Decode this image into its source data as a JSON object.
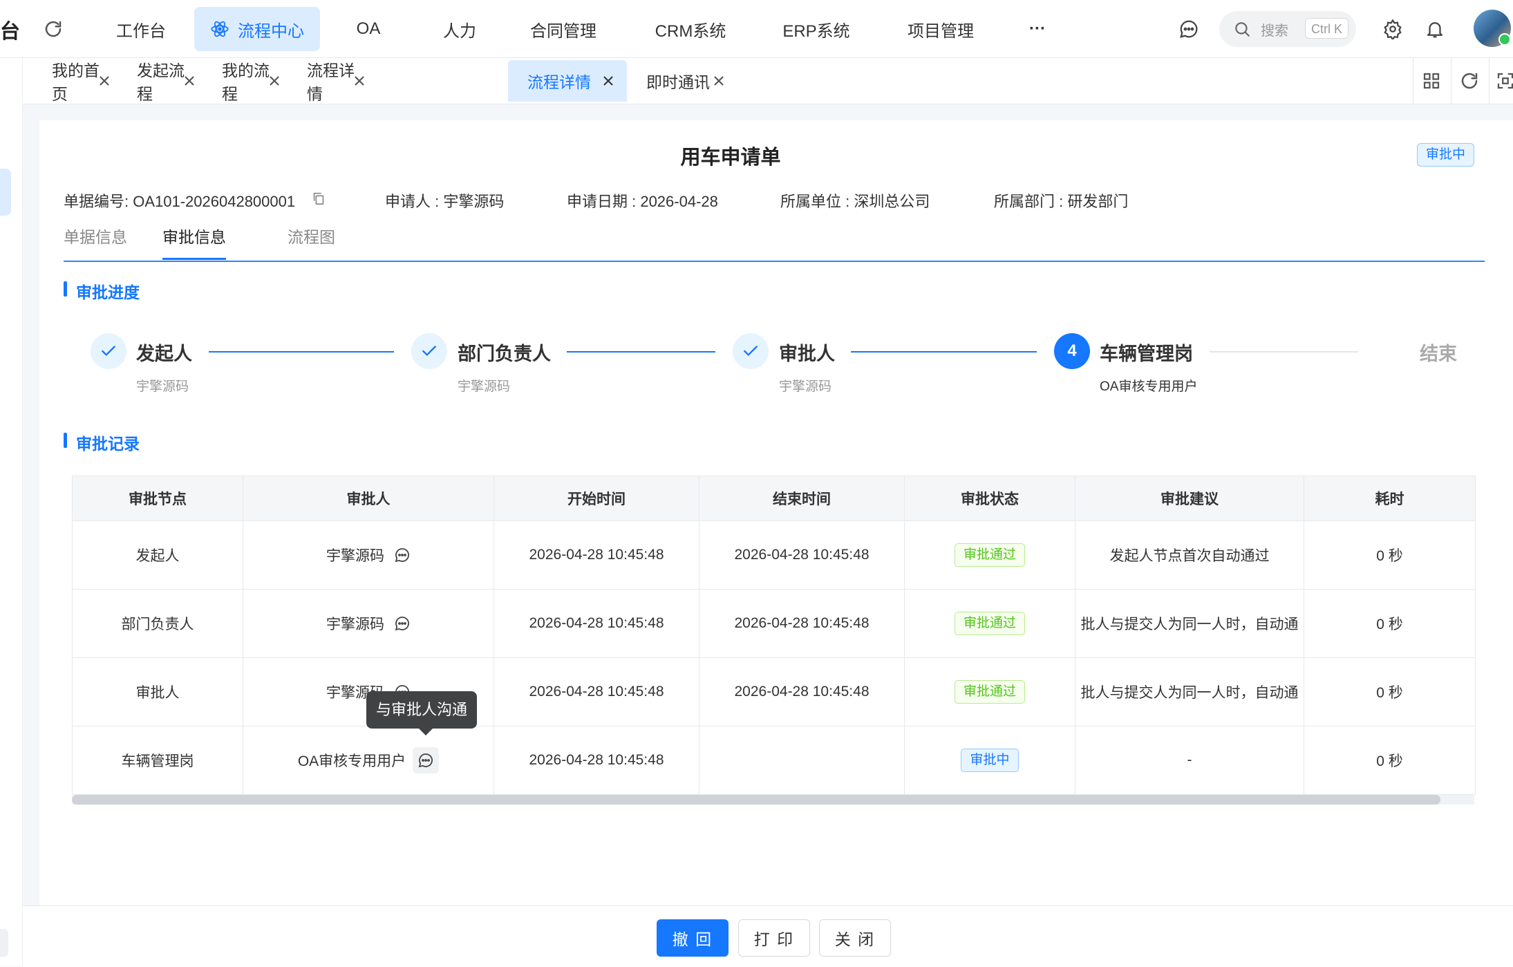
{
  "topbar": {
    "brand": "台",
    "nav": [
      {
        "label": "工作台"
      },
      {
        "label": "流程中心",
        "active": true
      },
      {
        "label": "OA"
      },
      {
        "label": "人力"
      },
      {
        "label": "合同管理"
      },
      {
        "label": "CRM系统"
      },
      {
        "label": "ERP系统"
      },
      {
        "label": "项目管理"
      },
      {
        "label": "···"
      }
    ],
    "search": {
      "placeholder": "搜索",
      "shortcut": "Ctrl K"
    }
  },
  "tabs": [
    {
      "label": "我的首页"
    },
    {
      "label": "发起流程"
    },
    {
      "label": "我的流程"
    },
    {
      "label": "流程详情"
    },
    {
      "label": "流程详情",
      "active": true
    },
    {
      "label": "即时通讯"
    }
  ],
  "doc": {
    "title": "用车申请单",
    "status": "审批中",
    "meta": {
      "number": "单据编号: OA101-2026042800001",
      "applicant": "申请人 : 宇擎源码",
      "date": "申请日期 : 2026-04-28",
      "unit": "所属单位 : 深圳总公司",
      "dept": "所属部门 : 研发部门"
    },
    "subtabs": [
      {
        "label": "单据信息"
      },
      {
        "label": "审批信息",
        "active": true
      },
      {
        "label": "流程图"
      }
    ]
  },
  "progress": {
    "title": "审批进度",
    "steps": [
      {
        "title": "发起人",
        "desc": "宇擎源码",
        "state": "done"
      },
      {
        "title": "部门负责人",
        "desc": "宇擎源码",
        "state": "done"
      },
      {
        "title": "审批人",
        "desc": "宇擎源码",
        "state": "done"
      },
      {
        "index": "4",
        "title": "车辆管理岗",
        "desc": "OA审核专用用户",
        "state": "current"
      },
      {
        "title": "结束",
        "state": "pending"
      }
    ]
  },
  "records": {
    "title": "审批记录",
    "columns": [
      "审批节点",
      "审批人",
      "开始时间",
      "结束时间",
      "审批状态",
      "审批建议",
      "耗时"
    ],
    "rows": [
      {
        "node": "发起人",
        "approver": "宇擎源码",
        "start": "2026-04-28 10:45:48",
        "end": "2026-04-28 10:45:48",
        "status": "审批通过",
        "advice": "发起人节点首次自动通过",
        "duration": "0 秒"
      },
      {
        "node": "部门负责人",
        "approver": "宇擎源码",
        "start": "2026-04-28 10:45:48",
        "end": "2026-04-28 10:45:48",
        "status": "审批通过",
        "advice": "批人与提交人为同一人时，自动通",
        "duration": "0 秒"
      },
      {
        "node": "审批人",
        "approver": "宇擎源码",
        "start": "2026-04-28 10:45:48",
        "end": "2026-04-28 10:45:48",
        "status": "审批通过",
        "advice": "批人与提交人为同一人时，自动通",
        "duration": "0 秒"
      },
      {
        "node": "车辆管理岗",
        "approver": "OA审核专用用户",
        "start": "2026-04-28 10:45:48",
        "end": "",
        "status": "审批中",
        "advice": "-",
        "duration": "0 秒"
      }
    ],
    "tooltip": "与审批人沟通"
  },
  "footer": {
    "recall": "撤 回",
    "print": "打 印",
    "close": "关 闭"
  },
  "colors": {
    "primary": "#1677ff",
    "primary_light": "#dcecff",
    "success": "#52c41a"
  }
}
